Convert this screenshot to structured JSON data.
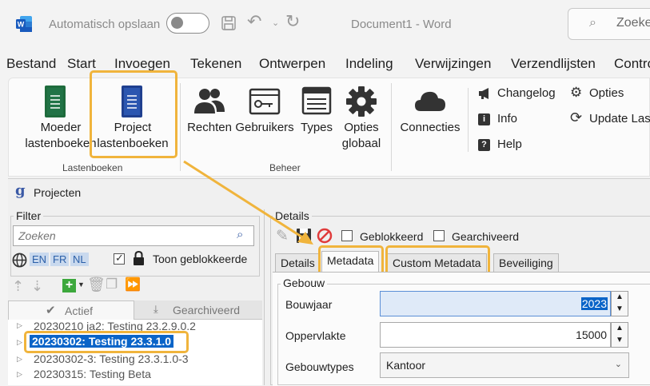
{
  "titlebar": {
    "autosave_label": "Automatisch opslaan",
    "document_title": "Document1  -  Word",
    "search_placeholder": "Zoeke"
  },
  "menu": [
    "Bestand",
    "Start",
    "Invoegen",
    "Tekenen",
    "Ontwerpen",
    "Indeling",
    "Verwijzingen",
    "Verzendlijsten",
    "Contro"
  ],
  "ribbon": {
    "moeder_line1": "Moeder",
    "moeder_line2": "lastenboeken",
    "project_line1": "Project",
    "project_line2": "lastenboeken",
    "group_lastenboeken": "Lastenboeken",
    "rechten": "Rechten",
    "gebruikers": "Gebruikers",
    "types": "Types",
    "opties_line1": "Opties",
    "opties_line2": "globaal",
    "group_beheer": "Beheer",
    "connecties": "Connecties",
    "changelog": "Changelog",
    "info": "Info",
    "help": "Help",
    "opties": "Opties",
    "update": "Update Last"
  },
  "app": {
    "title": "Projecten",
    "filter": {
      "legend": "Filter",
      "search_placeholder": "Zoeken",
      "lang": [
        "EN",
        "FR",
        "NL"
      ],
      "show_blocked": "Toon geblokkeerde",
      "show_blocked_checked": true
    },
    "list_tabs": {
      "active": "Actief",
      "archived": "Gearchiveerd"
    },
    "projects": [
      "20230210 ja2: Testing 23.2.9.0.2",
      "20230302: Testing 23.3.1.0",
      "20230302-3: Testing 23.3.1.0-3",
      "20230315: Testing Beta"
    ],
    "selected_project_index": 1,
    "details": {
      "legend": "Details",
      "blocked_label": "Geblokkeerd",
      "archived_label": "Gearchiveerd",
      "tabs": [
        "Details",
        "Metadata",
        "Custom Metadata",
        "Beveiliging"
      ],
      "active_tab_index": 1,
      "group_label": "Gebouw",
      "fields": {
        "bouwjaar_label": "Bouwjaar",
        "bouwjaar_value": "2023",
        "oppervlakte_label": "Oppervlakte",
        "oppervlakte_value": "15000",
        "gebouwtypes_label": "Gebouwtypes",
        "gebouwtypes_value": "Kantoor"
      }
    }
  },
  "colors": {
    "highlight": "#f0b43c",
    "word_blue": "#2b579a",
    "selection": "#0a64c8",
    "input_focus": "#dfeaf8"
  }
}
